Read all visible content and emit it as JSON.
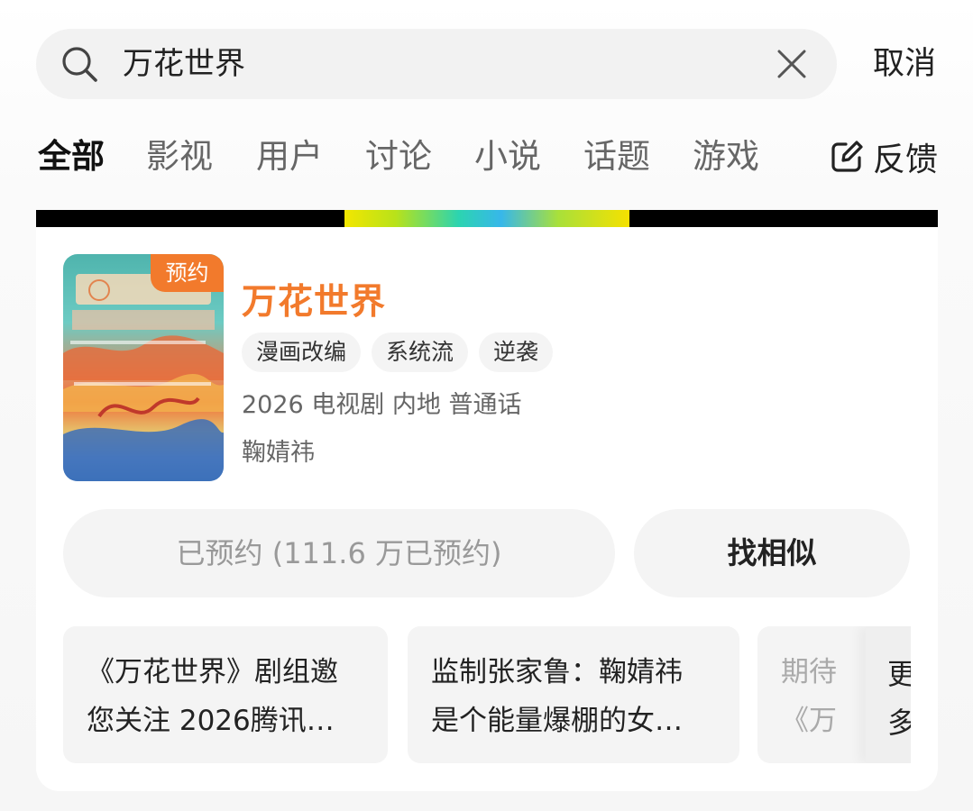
{
  "search": {
    "query": "万花世界",
    "cancel_label": "取消"
  },
  "tabs": [
    {
      "label": "全部",
      "active": true
    },
    {
      "label": "影视"
    },
    {
      "label": "用户"
    },
    {
      "label": "讨论"
    },
    {
      "label": "小说"
    },
    {
      "label": "话题"
    },
    {
      "label": "游戏"
    }
  ],
  "feedback_label": "反馈",
  "result": {
    "badge": "预约",
    "title": "万花世界",
    "tags": [
      "漫画改编",
      "系统流",
      "逆袭"
    ],
    "meta": "2026 电视剧 内地 普通话",
    "actor": "鞠婧祎",
    "reserve_label": "已预约 (111.6 万已预约)",
    "similar_label": "找相似",
    "news": [
      {
        "line1": "《万花世界》剧组邀",
        "line2": "您关注 2026腾讯…"
      },
      {
        "line1": "监制张家鲁：鞠婧祎",
        "line2": "是个能量爆棚的女…"
      },
      {
        "line1": "期待",
        "line2": "《万"
      }
    ],
    "more": [
      "更",
      "多"
    ]
  },
  "colors": {
    "accent": "#f27a2c"
  }
}
